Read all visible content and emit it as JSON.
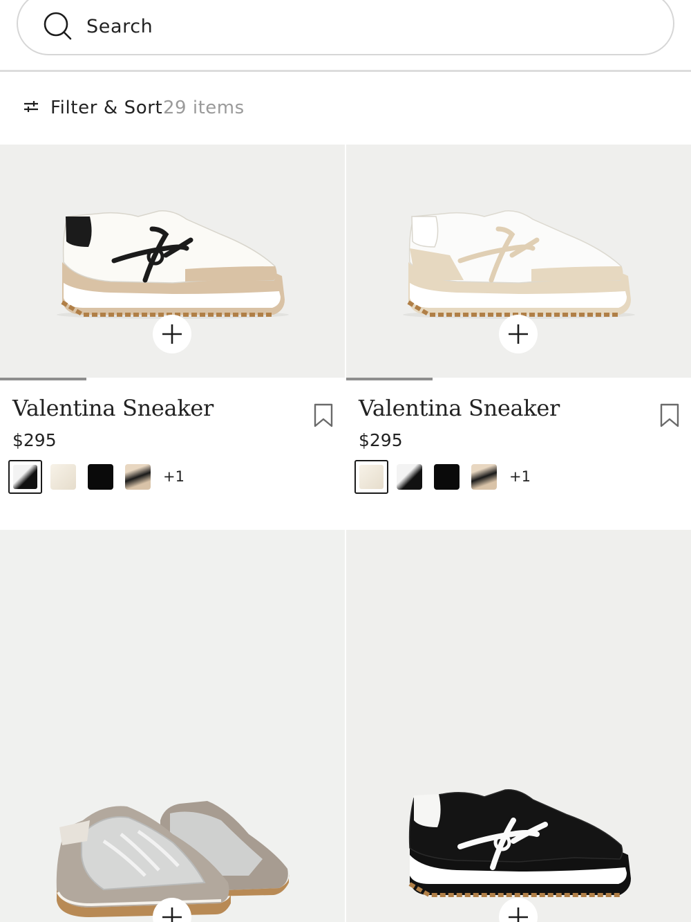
{
  "search": {
    "placeholder": "Search"
  },
  "toolbar": {
    "filter_label": "Filter & Sort",
    "count_label": "29 items"
  },
  "products": [
    {
      "name": "Valentina Sneaker",
      "price": "$295",
      "more_colors": "+1"
    },
    {
      "name": "Valentina Sneaker",
      "price": "$295",
      "more_colors": "+1"
    }
  ],
  "icons": [
    "search-icon",
    "filter-icon",
    "plus-icon",
    "bookmark-icon"
  ],
  "colors": {
    "image_bg": "#efefed",
    "divider": "#dcdcdc",
    "muted_text": "#9a9a9a",
    "text": "#222222"
  }
}
